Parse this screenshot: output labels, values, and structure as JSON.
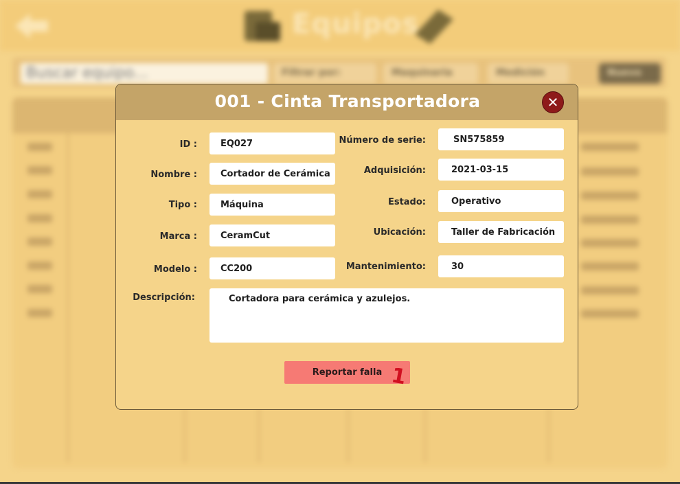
{
  "background": {
    "header_title": "Equipos",
    "search_placeholder": "Buscar equipo...",
    "filters": [
      "Filtrar por:",
      "Maquinaria",
      "Medición",
      "Nuevo"
    ]
  },
  "modal": {
    "title": "001 -  Cinta Transportadora",
    "close_label": "✕",
    "fields_left": [
      {
        "label": "ID :",
        "value": "EQ027"
      },
      {
        "label": "Nombre :",
        "value": "Cortador de Cerámica"
      },
      {
        "label": "Tipo :",
        "value": "Máquina"
      },
      {
        "label": "Marca :",
        "value": "CeramCut"
      },
      {
        "label": "Modelo :",
        "value": "CC200"
      }
    ],
    "fields_right": [
      {
        "label": "Número de serie:",
        "value": "SN575859"
      },
      {
        "label": "Adquisición:",
        "value": "2021-03-15"
      },
      {
        "label": "Estado:",
        "value": "Operativo"
      },
      {
        "label": "Ubicación:",
        "value": "Taller de Fabricación"
      },
      {
        "label": "Mantenimiento:",
        "value": "30"
      }
    ],
    "description": {
      "label": "Descripción:",
      "value": "Cortadora para cerámica y azulejos."
    },
    "report_button": "Reportar falla",
    "annotation_number": "1"
  },
  "colors": {
    "page_bg": "#f5d48a",
    "modal_header": "#c4a468",
    "close_button": "#8e1a1a",
    "report_button": "#f67a74",
    "annotation": "#d01020"
  }
}
